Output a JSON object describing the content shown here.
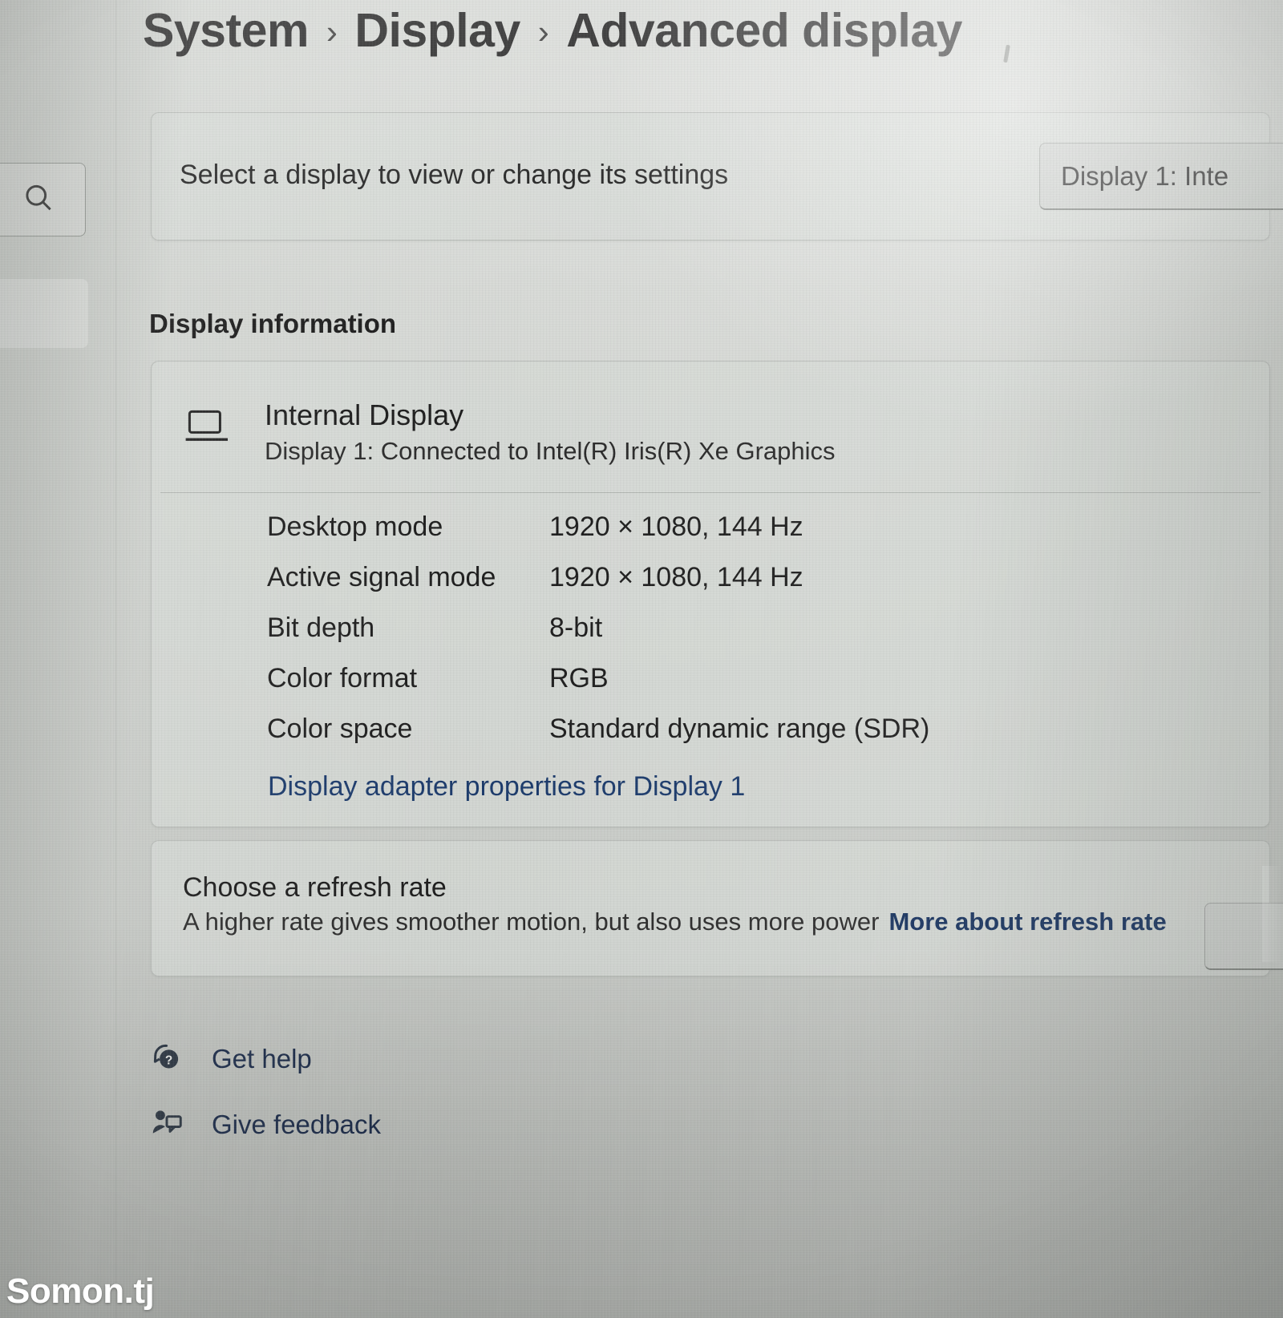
{
  "breadcrumb": {
    "items": [
      "System",
      "Display",
      "Advanced display"
    ],
    "separator": "›"
  },
  "sidebar": {
    "search_icon": "search-icon"
  },
  "select_display": {
    "label": "Select a display to view or change its settings",
    "dropdown_value": "Display 1: Inte"
  },
  "display_information": {
    "heading": "Display information",
    "device": {
      "icon": "monitor-icon",
      "name": "Internal Display",
      "connection": "Display 1: Connected to Intel(R) Iris(R) Xe Graphics"
    },
    "specs": [
      {
        "key": "Desktop mode",
        "value": "1920 × 1080, 144 Hz"
      },
      {
        "key": "Active signal mode",
        "value": "1920 × 1080, 144 Hz"
      },
      {
        "key": "Bit depth",
        "value": "8-bit"
      },
      {
        "key": "Color format",
        "value": "RGB"
      },
      {
        "key": "Color space",
        "value": "Standard dynamic range (SDR)"
      }
    ],
    "adapter_link": "Display adapter properties for Display 1"
  },
  "refresh_rate": {
    "title": "Choose a refresh rate",
    "description": "A higher rate gives smoother motion, but also uses more power",
    "more_link": "More about refresh rate"
  },
  "footer": [
    {
      "icon": "help-icon",
      "label": "Get help"
    },
    {
      "icon": "feedback-icon",
      "label": "Give feedback"
    }
  ],
  "watermark": "Somon.tj",
  "colors": {
    "page_background": "#c9ccc8",
    "card_background": "#d6d9d5",
    "text_primary": "#1d1d1d",
    "link": "#1b3a6b",
    "footer_link": "#1c2c4a"
  }
}
